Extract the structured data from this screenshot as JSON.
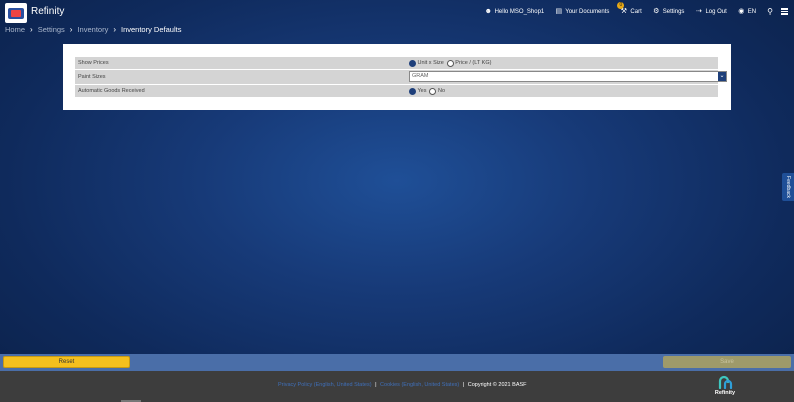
{
  "header": {
    "app_title": "Refinity",
    "user_greeting": "Hello MSO_Shop1",
    "documents_label": "Your Documents",
    "cart_label": "Cart",
    "cart_count": "0",
    "settings_label": "Settings",
    "logout_label": "Log Out",
    "language": "EN"
  },
  "breadcrumb": {
    "home": "Home",
    "settings": "Settings",
    "inventory": "Inventory",
    "current": "Inventory Defaults"
  },
  "form": {
    "show_prices": {
      "label": "Show Prices",
      "options": [
        "Unit x Size",
        "Price / (LT KG)"
      ],
      "selected": "Unit x Size"
    },
    "paint_sizes": {
      "label": "Paint Sizes",
      "value": "GRAM"
    },
    "automatic_goods_received": {
      "label": "Automatic Goods Received",
      "options": [
        "Yes",
        "No"
      ],
      "selected": "Yes"
    }
  },
  "feedback_label": "Feedback",
  "actions": {
    "reset_label": "Reset",
    "save_label": "Save"
  },
  "footer": {
    "privacy": "Privacy Policy (English, United States)",
    "cookies": "Cookies (English, United States)",
    "copyright": "Copyright © 2021 BASF",
    "brand": "Refinity"
  },
  "colors": {
    "accent": "#1e3f7a",
    "reset_button": "#f4c01e",
    "action_bar": "#4a6ea8",
    "footer": "#3d3d3d"
  }
}
